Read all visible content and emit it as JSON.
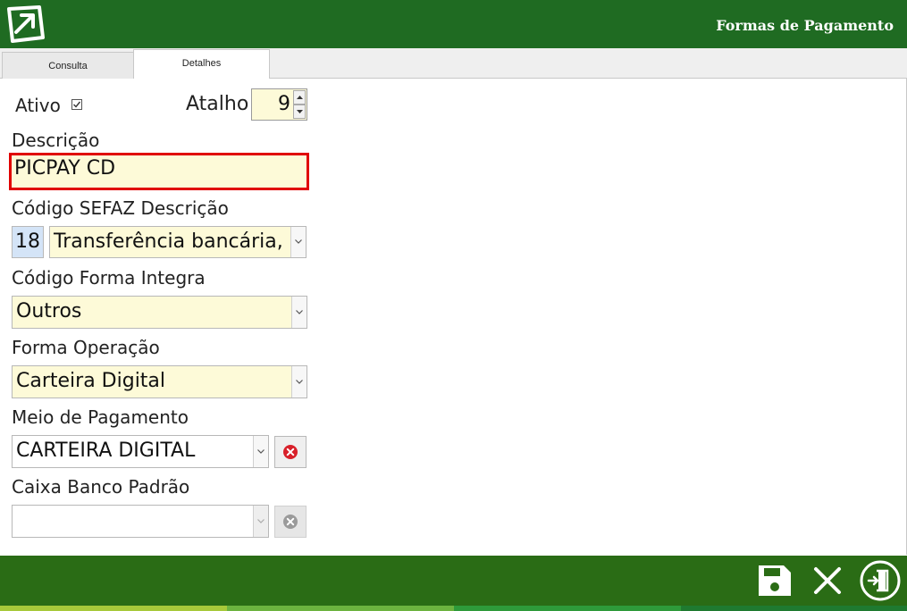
{
  "header": {
    "title": "Formas de Pagamento"
  },
  "tabs": [
    {
      "label": "Consulta",
      "active": false
    },
    {
      "label": "Detalhes",
      "active": true
    }
  ],
  "form": {
    "ativo_label": "Ativo",
    "ativo_checked": true,
    "atalho_label": "Atalho",
    "atalho_value": "9",
    "descricao_label": "Descrição",
    "descricao_value": "PICPAY CD",
    "sefaz_label": "Código SEFAZ Descrição",
    "sefaz_code": "18",
    "sefaz_desc": "Transferência bancária, Carteira Digital",
    "integra_label": "Código Forma Integra",
    "integra_value": "Outros",
    "operacao_label": "Forma Operação",
    "operacao_value": "Carteira Digital",
    "meio_label": "Meio de Pagamento",
    "meio_value": "CARTEIRA DIGITAL",
    "caixa_label": "Caixa Banco Padrão",
    "caixa_value": ""
  },
  "colors": {
    "header_bg": "#1f6b22",
    "footer_bg": "#2a6c15",
    "field_bg": "#fdfad8",
    "highlight_border": "#e00000",
    "strip": [
      "#a7c93a",
      "#6cb33f",
      "#2e9a3a",
      "#1f7a30"
    ]
  },
  "icons": {
    "logo": "arrow-box-logo",
    "save": "floppy-disk-icon",
    "cancel": "close-x-icon",
    "exit": "exit-door-icon",
    "clear": "red-x-circle-icon"
  }
}
